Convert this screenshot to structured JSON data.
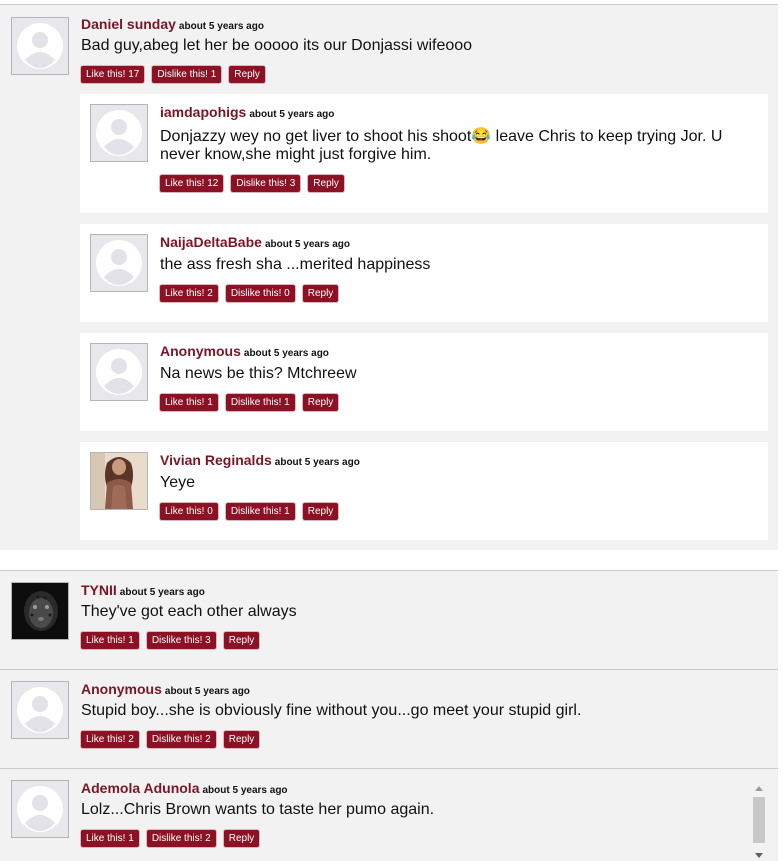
{
  "comments": [
    {
      "author": "Daniel sunday",
      "time": "about 5 years ago",
      "text": "Bad guy,abeg let her be ooooo its our Donjassi wifeooo",
      "like": "Like this! 17",
      "dislike": "Dislike this! 1",
      "reply": "Reply",
      "avatar": "default-avatar",
      "replies": [
        {
          "author": "iamdapohigs",
          "time": "about 5 years ago",
          "text": "Donjazzy wey no get liver to shoot his shoot😂 leave Chris to keep trying Jor. U never know,she might just forgive him.",
          "like": "Like this! 12",
          "dislike": "Dislike this! 3",
          "reply": "Reply",
          "avatar": "default-avatar"
        },
        {
          "author": "NaijaDeltaBabe",
          "time": "about 5 years ago",
          "text": "the ass fresh sha ...merited happiness",
          "like": "Like this! 2",
          "dislike": "Dislike this! 0",
          "reply": "Reply",
          "avatar": "default-avatar"
        },
        {
          "author": "Anonymous",
          "time": "about 5 years ago",
          "text": "Na news be this? Mtchreew",
          "like": "Like this! 1",
          "dislike": "Dislike this! 1",
          "reply": "Reply",
          "avatar": "default-avatar"
        },
        {
          "author": "Vivian Reginalds",
          "time": "about 5 years ago",
          "text": "Yeye",
          "like": "Like this! 0",
          "dislike": "Dislike this! 1",
          "reply": "Reply",
          "avatar": "user-photo-avatar"
        }
      ]
    },
    {
      "author": "TYNII",
      "time": "about 5 years ago",
      "text": "They've got each other always",
      "like": "Like this! 1",
      "dislike": "Dislike this! 3",
      "reply": "Reply",
      "avatar": "leopard-photo-avatar"
    },
    {
      "author": "Anonymous",
      "time": "about 5 years ago",
      "text": "Stupid boy...she is obviously fine without you...go meet your stupid girl.",
      "like": "Like this! 2",
      "dislike": "Dislike this! 2",
      "reply": "Reply",
      "avatar": "default-avatar"
    },
    {
      "author": "Ademola Adunola",
      "time": "about 5 years ago",
      "text": "Lolz...Chris Brown wants to taste her pumo again.",
      "like": "Like this! 1",
      "dislike": "Dislike this! 2",
      "reply": "Reply",
      "avatar": "default-avatar"
    }
  ],
  "colors": {
    "author": "#7a1626",
    "button_bg": "#8c1124",
    "thread_bg": "#f2f2f2",
    "reply_bg": "#ffffff"
  }
}
